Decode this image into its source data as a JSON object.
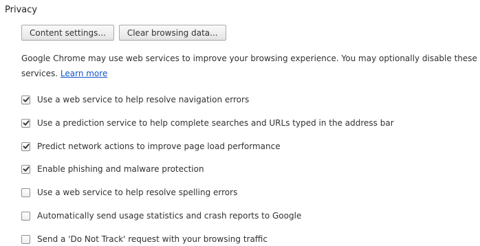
{
  "privacy": {
    "title": "Privacy",
    "buttons": {
      "content_settings": "Content settings...",
      "clear_browsing": "Clear browsing data..."
    },
    "description": "Google Chrome may use web services to improve your browsing experience. You may optionally disable these services.",
    "learn_more": "Learn more",
    "options": [
      {
        "label": "Use a web service to help resolve navigation errors",
        "checked": true
      },
      {
        "label": "Use a prediction service to help complete searches and URLs typed in the address bar",
        "checked": true
      },
      {
        "label": "Predict network actions to improve page load performance",
        "checked": true
      },
      {
        "label": "Enable phishing and malware protection",
        "checked": true
      },
      {
        "label": "Use a web service to help resolve spelling errors",
        "checked": false
      },
      {
        "label": "Automatically send usage statistics and crash reports to Google",
        "checked": false
      },
      {
        "label": "Send a 'Do Not Track' request with your browsing traffic",
        "checked": false
      }
    ]
  },
  "colors": {
    "link": "#1155cc",
    "text": "#303030",
    "checkmark": "#333333"
  }
}
